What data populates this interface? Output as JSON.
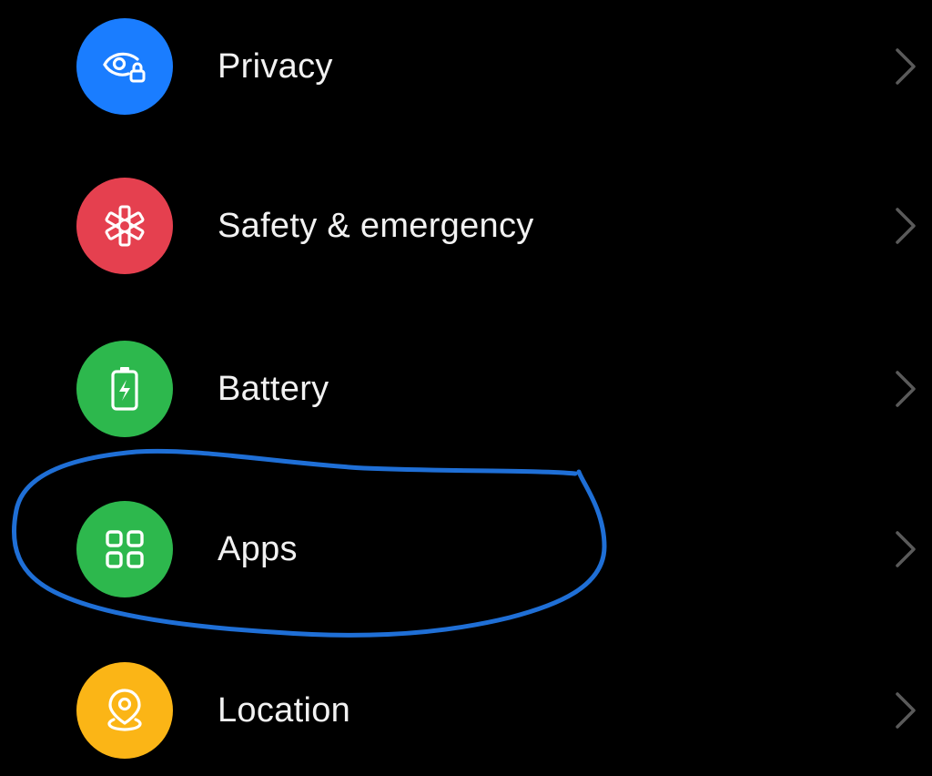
{
  "settings": {
    "items": [
      {
        "label": "Privacy",
        "icon": "privacy-eye-lock-icon",
        "color": "#1a7dff"
      },
      {
        "label": "Safety & emergency",
        "icon": "medical-asterisk-icon",
        "color": "#e5404f"
      },
      {
        "label": "Battery",
        "icon": "battery-charging-icon",
        "color": "#2db84d"
      },
      {
        "label": "Apps",
        "icon": "apps-grid-icon",
        "color": "#2db84d"
      },
      {
        "label": "Location",
        "icon": "location-pin-icon",
        "color": "#fbb516"
      }
    ],
    "chevron_icon": "chevron-right-icon",
    "chevron_color": "#5a5a5a",
    "text_color": "#f2f2f2",
    "background": "#000000"
  },
  "annotation": {
    "type": "hand-drawn-circle",
    "color": "#1f6fd6",
    "highlighted_item": "Apps"
  }
}
